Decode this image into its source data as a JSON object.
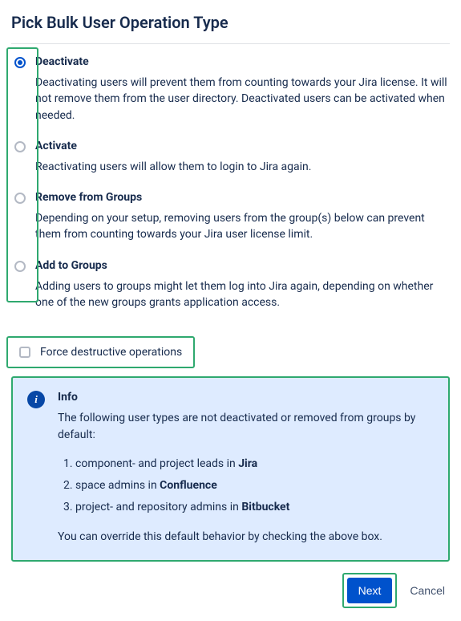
{
  "title": "Pick Bulk User Operation Type",
  "options": [
    {
      "label": "Deactivate",
      "desc": "Deactivating users will prevent them from counting towards your Jira license. It will not remove them from the user directory. Deactivated users can be activated when needed.",
      "checked": true
    },
    {
      "label": "Activate",
      "desc": "Reactivating users will allow them to login to Jira again.",
      "checked": false
    },
    {
      "label": "Remove from Groups",
      "desc": "Depending on your setup, removing users from the group(s) below can prevent them from counting towards your Jira user license limit.",
      "checked": false
    },
    {
      "label": "Add to Groups",
      "desc": "Adding users to groups might let them log into Jira again, depending on whether one of the new groups grants application access.",
      "checked": false
    }
  ],
  "force_destructive_label": "Force destructive operations",
  "info": {
    "title": "Info",
    "intro": "The following user types are not deactivated or removed from groups by default:",
    "items": [
      {
        "prefix": "component- and project leads in ",
        "bold": "Jira"
      },
      {
        "prefix": "space admins in ",
        "bold": "Confluence"
      },
      {
        "prefix": "project- and repository admins in ",
        "bold": "Bitbucket"
      }
    ],
    "outro": "You can override this default behavior by checking the above box."
  },
  "buttons": {
    "next": "Next",
    "cancel": "Cancel"
  }
}
